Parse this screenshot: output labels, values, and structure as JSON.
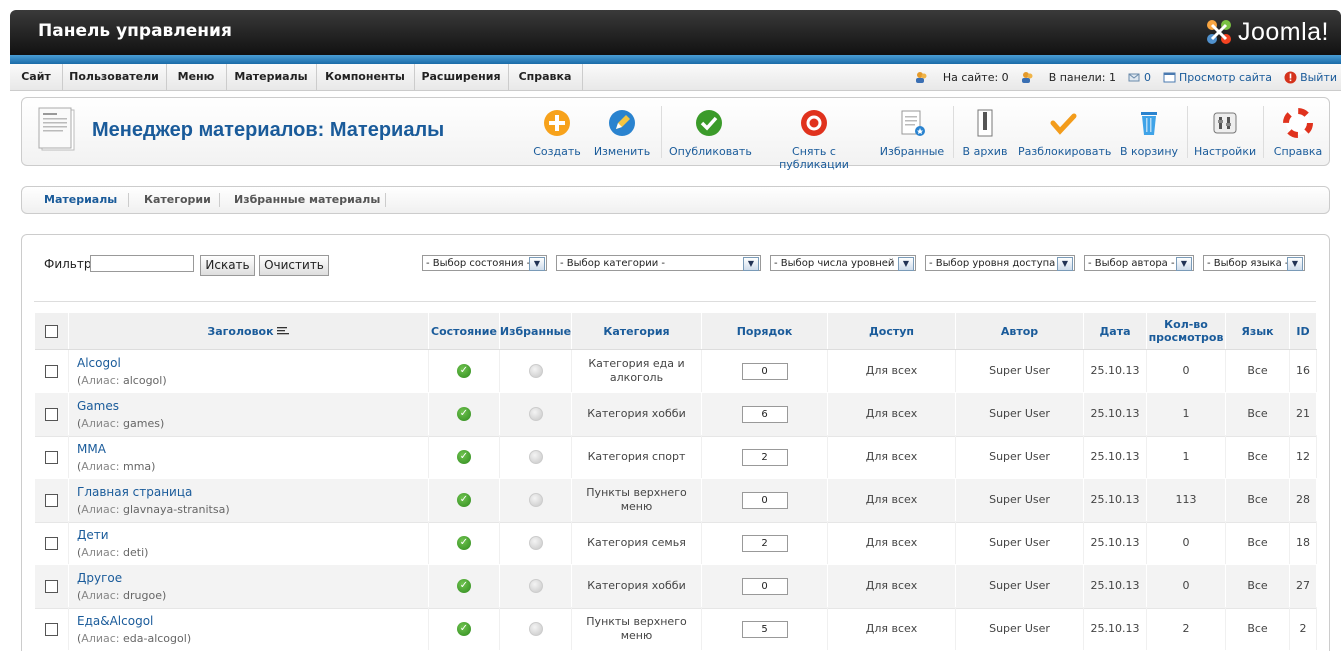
{
  "header": {
    "title": "Панель управления",
    "logo_text": "Joomla!"
  },
  "menu": [
    "Сайт",
    "Пользователи",
    "Меню",
    "Материалы",
    "Компоненты",
    "Расширения",
    "Справка"
  ],
  "status": {
    "on_site": "На сайте: 0",
    "in_panel": "В панели: 1",
    "messages": "0",
    "view_site": "Просмотр сайта",
    "logout": "Выйти"
  },
  "toolbar": {
    "title": "Менеджер материалов: Материалы",
    "buttons": [
      "Создать",
      "Изменить",
      "Опубликовать",
      "Снять с публикации",
      "Избранные",
      "В архив",
      "Разблокировать",
      "В корзину",
      "Настройки",
      "Справка"
    ]
  },
  "tabs": [
    "Материалы",
    "Категории",
    "Избранные материалы"
  ],
  "filter": {
    "label": "Фильтр:",
    "search_button": "Искать",
    "clear_button": "Очистить",
    "selects": [
      "- Выбор состояния -",
      "- Выбор категории -",
      "- Выбор числа уровней -",
      "- Выбор уровня доступа -",
      "- Выбор автора -",
      "- Выбор языка -"
    ]
  },
  "table": {
    "headers": [
      "Заголовок",
      "Состояние",
      "Избранные",
      "Категория",
      "Порядок",
      "Доступ",
      "Автор",
      "Дата",
      "Кол-во просмотров",
      "Язык",
      "ID"
    ],
    "alias_label": "Алиас:",
    "rows": [
      {
        "title": "Alcogol",
        "alias": "alcogol",
        "category": "Категория еда и алкоголь",
        "order": "0",
        "access": "Для всех",
        "author": "Super User",
        "date": "25.10.13",
        "hits": "0",
        "lang": "Все",
        "id": "16"
      },
      {
        "title": "Games",
        "alias": "games",
        "category": "Категория хобби",
        "order": "6",
        "access": "Для всех",
        "author": "Super User",
        "date": "25.10.13",
        "hits": "1",
        "lang": "Все",
        "id": "21"
      },
      {
        "title": "MMA",
        "alias": "mma",
        "category": "Категория спорт",
        "order": "2",
        "access": "Для всех",
        "author": "Super User",
        "date": "25.10.13",
        "hits": "1",
        "lang": "Все",
        "id": "12"
      },
      {
        "title": "Главная страница",
        "alias": "glavnaya-stranitsa",
        "category": "Пункты верхнего меню",
        "order": "0",
        "access": "Для всех",
        "author": "Super User",
        "date": "25.10.13",
        "hits": "113",
        "lang": "Все",
        "id": "28"
      },
      {
        "title": "Дети",
        "alias": "deti",
        "category": "Категория семья",
        "order": "2",
        "access": "Для всех",
        "author": "Super User",
        "date": "25.10.13",
        "hits": "0",
        "lang": "Все",
        "id": "18"
      },
      {
        "title": "Другое",
        "alias": "drugoe",
        "category": "Категория хобби",
        "order": "0",
        "access": "Для всех",
        "author": "Super User",
        "date": "25.10.13",
        "hits": "0",
        "lang": "Все",
        "id": "27"
      },
      {
        "title": "Еда&Alcogol",
        "alias": "eda-alcogol",
        "category": "Пункты верхнего меню",
        "order": "5",
        "access": "Для всех",
        "author": "Super User",
        "date": "25.10.13",
        "hits": "2",
        "lang": "Все",
        "id": "2"
      }
    ]
  }
}
